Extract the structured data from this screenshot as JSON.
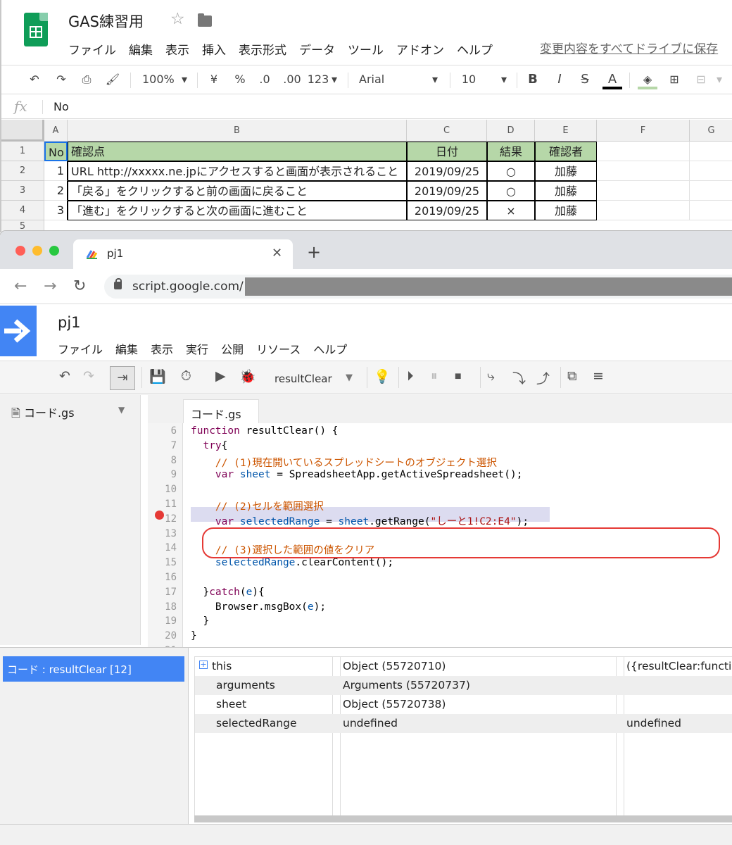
{
  "sheets": {
    "title": "GAS練習用",
    "menu": [
      "ファイル",
      "編集",
      "表示",
      "挿入",
      "表示形式",
      "データ",
      "ツール",
      "アドオン",
      "ヘルプ"
    ],
    "saved_status": "変更内容をすべてドライブに保存",
    "toolbar": {
      "zoom": "100%",
      "currency": "¥",
      "percent": "%",
      "dec_minus": ".0",
      "dec_plus": ".00",
      "format": "123",
      "font": "Arial",
      "size": "10",
      "bold": "B",
      "italic": "I",
      "strike": "S",
      "text_color": "A"
    },
    "formula_bar": {
      "fx": "fx",
      "value": "No"
    },
    "columns": [
      "A",
      "B",
      "C",
      "D",
      "E",
      "F",
      "G"
    ],
    "rows": [
      "1",
      "2",
      "3",
      "4",
      "5"
    ],
    "header_row": [
      "No",
      "確認点",
      "日付",
      "結果",
      "確認者"
    ],
    "data_rows": [
      [
        "1",
        "URL http://xxxxx.ne.jpにアクセスすると画面が表示されること",
        "2019/09/25",
        "○",
        "加藤"
      ],
      [
        "2",
        "「戻る」をクリックすると前の画面に戻ること",
        "2019/09/25",
        "○",
        "加藤"
      ],
      [
        "3",
        "「進む」をクリックすると次の画面に進むこと",
        "2019/09/25",
        "×",
        "加藤"
      ]
    ],
    "header_color": "#b6d7a8"
  },
  "browser": {
    "tab_title": "pj1",
    "url": "script.google.com/"
  },
  "gas": {
    "project": "pj1",
    "menu": [
      "ファイル",
      "編集",
      "表示",
      "実行",
      "公開",
      "リソース",
      "ヘルプ"
    ],
    "function_select": "resultClear",
    "file": "コード.gs",
    "editor_tab": "コード.gs",
    "line_numbers": [
      "6",
      "7",
      "8",
      "9",
      "10",
      "11",
      "12",
      "13",
      "14",
      "15",
      "16",
      "17",
      "18",
      "19",
      "20",
      "21"
    ],
    "breakpoint_line": "12",
    "code_lines": [
      [
        {
          "t": "function ",
          "c": "kw"
        },
        {
          "t": "resultClear() {",
          "c": ""
        }
      ],
      [
        {
          "t": "  ",
          "c": ""
        },
        {
          "t": "try",
          "c": "kw"
        },
        {
          "t": "{",
          "c": ""
        }
      ],
      [
        {
          "t": "    // (1)現在開いているスプレッドシートのオブジェクト選択",
          "c": "cm"
        }
      ],
      [
        {
          "t": "    ",
          "c": ""
        },
        {
          "t": "var ",
          "c": "kw"
        },
        {
          "t": "sheet",
          "c": "vr"
        },
        {
          "t": " = SpreadsheetApp.getActiveSpreadsheet();",
          "c": ""
        }
      ],
      [
        {
          "t": "",
          "c": ""
        }
      ],
      [
        {
          "t": "    // (2)セルを範囲選択",
          "c": "cm"
        }
      ],
      [
        {
          "t": "    ",
          "c": ""
        },
        {
          "t": "var ",
          "c": "kw"
        },
        {
          "t": "selectedRange",
          "c": "vr"
        },
        {
          "t": " = ",
          "c": ""
        },
        {
          "t": "sheet",
          "c": "vr"
        },
        {
          "t": ".getRange(",
          "c": ""
        },
        {
          "t": "\"しーと1!C2:E4\"",
          "c": "st"
        },
        {
          "t": ");",
          "c": ""
        }
      ],
      [
        {
          "t": "",
          "c": ""
        }
      ],
      [
        {
          "t": "    // (3)選択した範囲の値をクリア",
          "c": "cm"
        }
      ],
      [
        {
          "t": "    ",
          "c": ""
        },
        {
          "t": "selectedRange",
          "c": "vr"
        },
        {
          "t": ".clearContent();",
          "c": ""
        }
      ],
      [
        {
          "t": "",
          "c": ""
        }
      ],
      [
        {
          "t": "  }",
          "c": ""
        },
        {
          "t": "catch",
          "c": "kw"
        },
        {
          "t": "(",
          "c": ""
        },
        {
          "t": "e",
          "c": "vr"
        },
        {
          "t": "){",
          "c": ""
        }
      ],
      [
        {
          "t": "    Browser.msgBox(",
          "c": ""
        },
        {
          "t": "e",
          "c": "vr"
        },
        {
          "t": ");",
          "c": ""
        }
      ],
      [
        {
          "t": "  }",
          "c": ""
        }
      ],
      [
        {
          "t": "}",
          "c": ""
        }
      ],
      [
        {
          "t": "",
          "c": ""
        }
      ]
    ],
    "call_stack": "コード : resultClear [12]",
    "variables": [
      {
        "name": "this",
        "value": "Object (55720710)",
        "extra": "({resultClear:function"
      },
      {
        "name": "arguments",
        "value": "Arguments (55720737)",
        "extra": ""
      },
      {
        "name": "sheet",
        "value": "Object (55720738)",
        "extra": ""
      },
      {
        "name": "selectedRange",
        "value": "undefined",
        "extra": "undefined"
      }
    ]
  }
}
